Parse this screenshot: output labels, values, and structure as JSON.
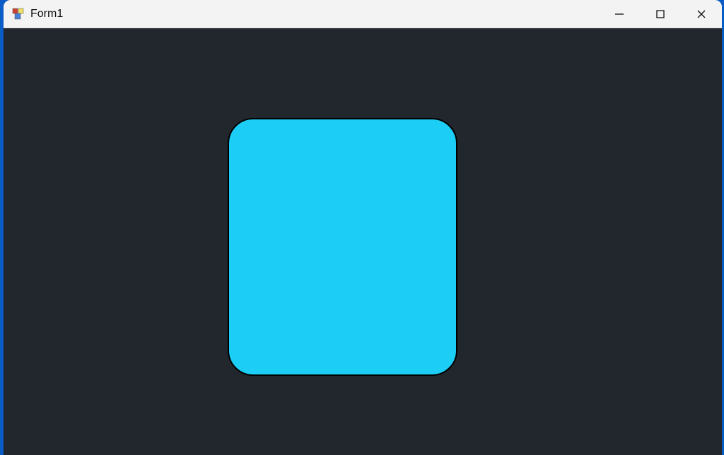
{
  "window": {
    "title": "Form1"
  },
  "panel": {
    "fill_color": "#1ccdf5",
    "border_color": "#000000",
    "corner_radius": 36
  },
  "client_bg": "#22272e"
}
